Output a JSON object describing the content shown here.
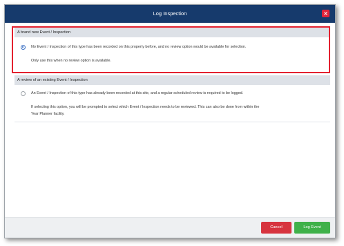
{
  "dialog": {
    "title": "Log Inspection",
    "close_symbol": "×"
  },
  "sections": {
    "new": {
      "header": "A brand new Event / Inspection",
      "selected": true,
      "line1": "No Event / Inspection of this type has been recorded on this property before, and no review option would be available for selection.",
      "line2": "Only use this when no review option is available."
    },
    "review": {
      "header": "A review of an existing Event / Inspection",
      "selected": false,
      "line1": "An Event / Inspection of this type has already been recorded at this site, and a regular scheduled review is required to be logged.",
      "line2": "If selecting this option, you will be prompted to select which Event / Inspection needs to be reviewed. This can also be done from within the",
      "line3": "Year Planner facility."
    }
  },
  "footer": {
    "cancel_label": "Cancel",
    "log_label": "Log Event"
  },
  "colors": {
    "titlebar": "#163a6c",
    "highlight": "#e3212f",
    "cancel": "#d7343f",
    "log": "#3fb14a"
  }
}
